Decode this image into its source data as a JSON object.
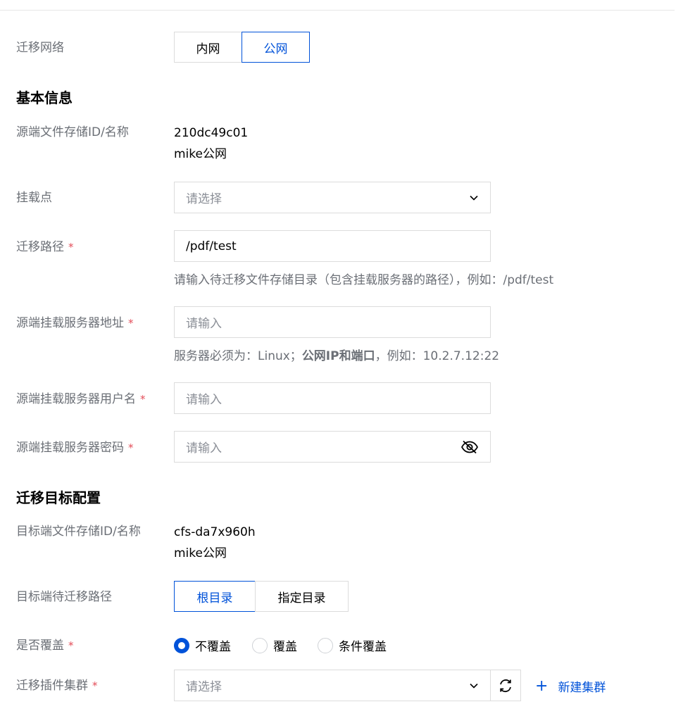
{
  "network": {
    "label": "迁移网络",
    "options": [
      "内网",
      "公网"
    ],
    "selected": "公网"
  },
  "basic": {
    "title": "基本信息",
    "source_id_label": "源端文件存储ID/名称",
    "source_id": "210dc49c01",
    "source_name": "mike公网",
    "mount_label": "挂载点",
    "mount_placeholder": "请选择",
    "path_label": "迁移路径",
    "path_value": "/pdf/test",
    "path_help": "请输入待迁移文件存储目录（包含挂载服务器的路径），例如：/pdf/test",
    "server_addr_label": "源端挂载服务器地址",
    "server_addr_placeholder": "请输入",
    "server_help_prefix": "服务器必须为：Linux；",
    "server_help_bold": "公网IP和端口",
    "server_help_suffix": "，例如：10.2.7.12:22",
    "username_label": "源端挂载服务器用户名",
    "username_placeholder": "请输入",
    "password_label": "源端挂载服务器密码",
    "password_placeholder": "请输入",
    "required_mark": "*"
  },
  "target": {
    "title": "迁移目标配置",
    "target_id_label": "目标端文件存储ID/名称",
    "target_id": "cfs-da7x960h",
    "target_name": "mike公网",
    "target_path_label": "目标端待迁移路径",
    "target_path_options": [
      "根目录",
      "指定目录"
    ],
    "target_path_selected": "根目录",
    "overwrite_label": "是否覆盖",
    "overwrite_options": [
      "不覆盖",
      "覆盖",
      "条件覆盖"
    ],
    "overwrite_selected": "不覆盖",
    "cluster_label": "迁移插件集群",
    "cluster_placeholder": "请选择",
    "new_cluster_link": "新建集群",
    "plus_glyph": "+"
  },
  "icons": {
    "dropdown": "chevron-down-icon",
    "eye": "eye-off-icon",
    "refresh": "refresh-icon",
    "plus": "plus-icon"
  },
  "colors": {
    "primary": "#0052d9",
    "required": "#e34d59",
    "label": "#6b6f76",
    "border": "#dcdcdc"
  }
}
